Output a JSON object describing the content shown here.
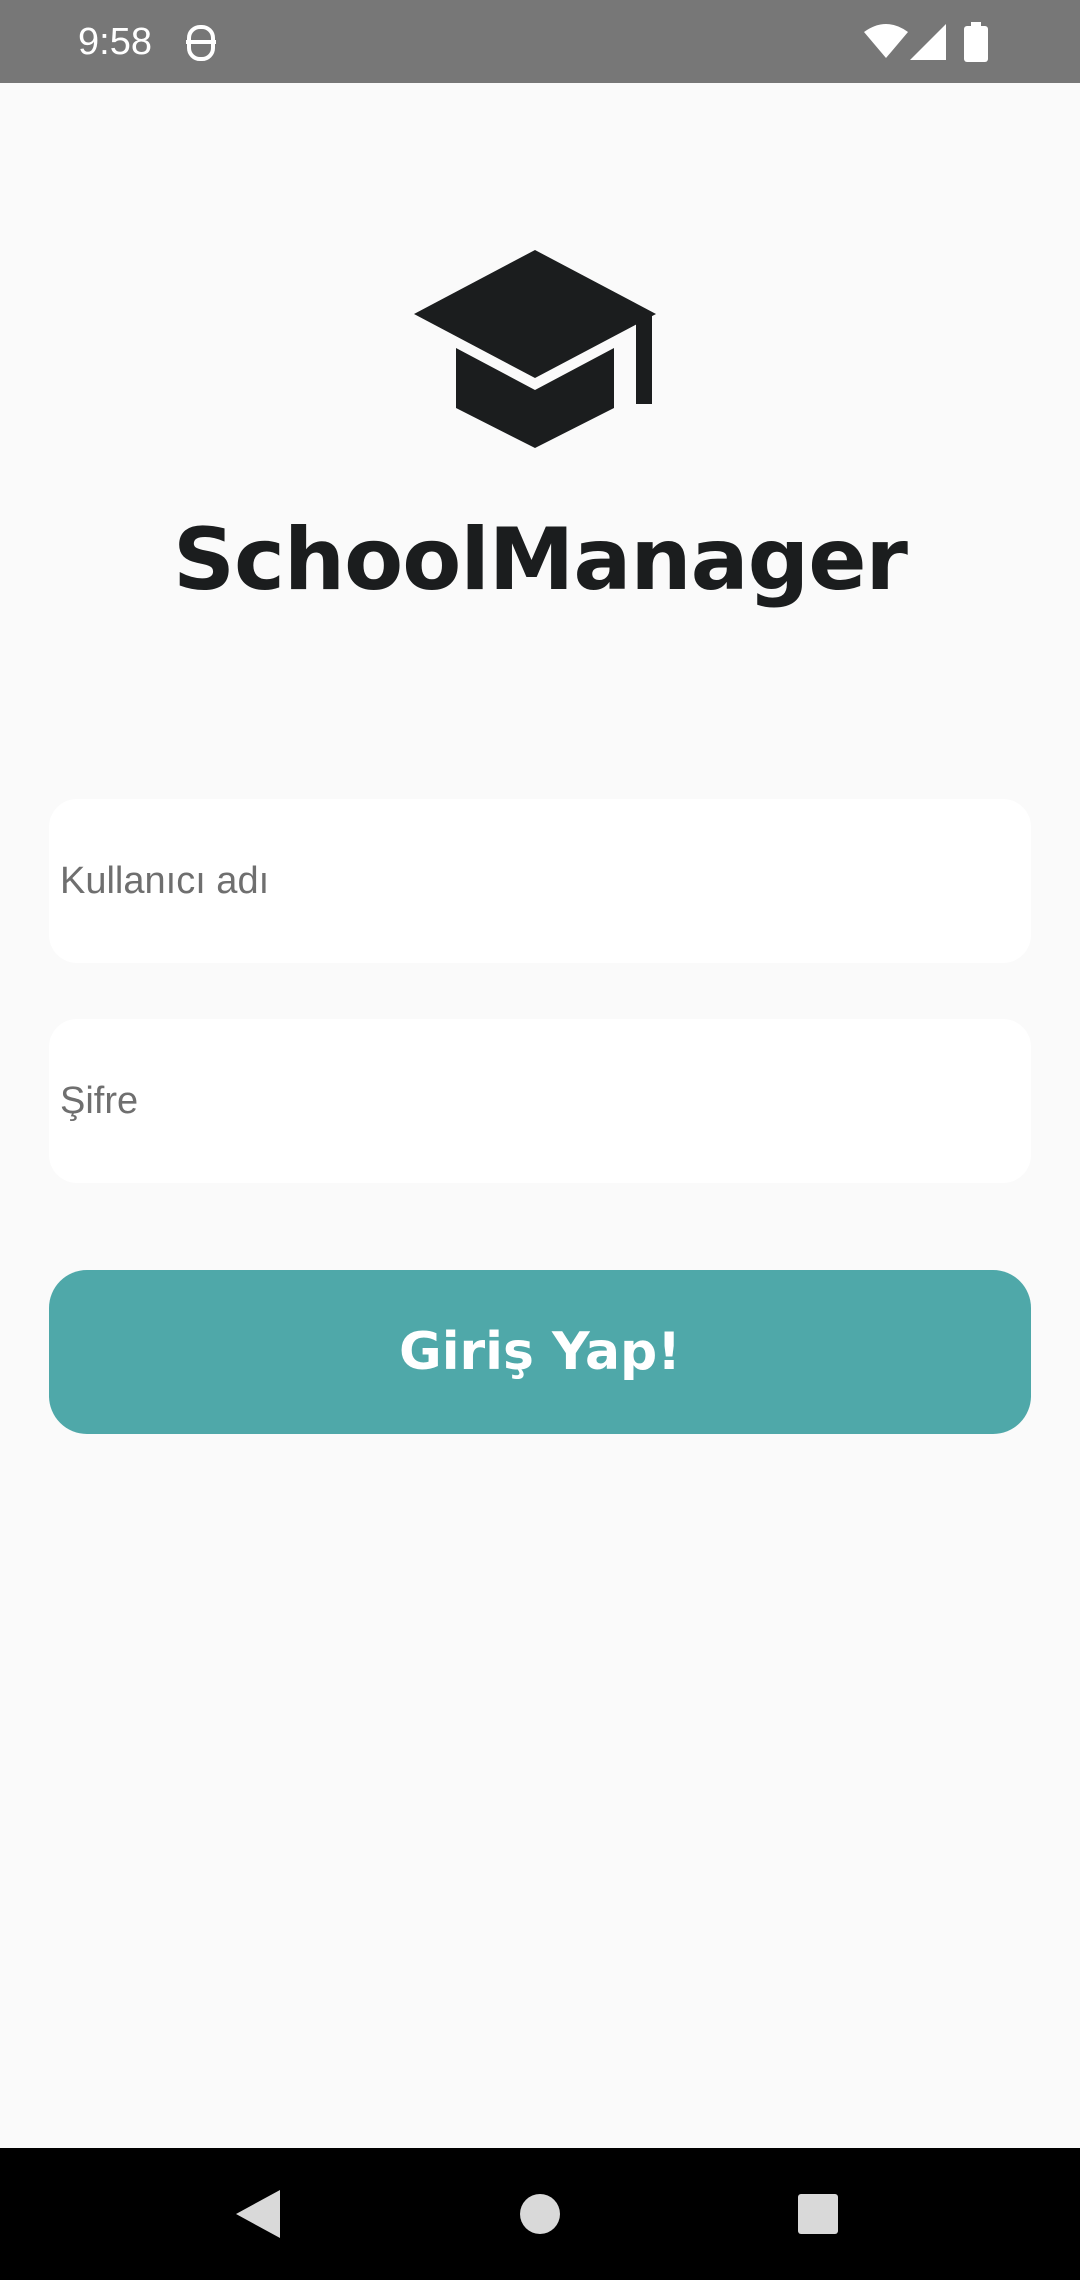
{
  "status_bar": {
    "time": "9:58",
    "icons": [
      "app-notification-icon",
      "wifi-icon",
      "signal-icon",
      "battery-icon"
    ]
  },
  "logo": {
    "icon": "graduation-cap-icon"
  },
  "app": {
    "title": "SchoolManager"
  },
  "form": {
    "username_placeholder": "Kullanıcı adı",
    "username_value": "",
    "password_placeholder": "Şifre",
    "password_value": "",
    "login_label": "Giriş Yap!"
  },
  "nav_bar": {
    "icons": [
      "back-icon",
      "home-icon",
      "recents-icon"
    ]
  },
  "colors": {
    "background": "#fafafa",
    "status_bar": "#777777",
    "accent": "#4fa8a9",
    "title": "#1b1d1e",
    "input_background": "#ffffff"
  }
}
